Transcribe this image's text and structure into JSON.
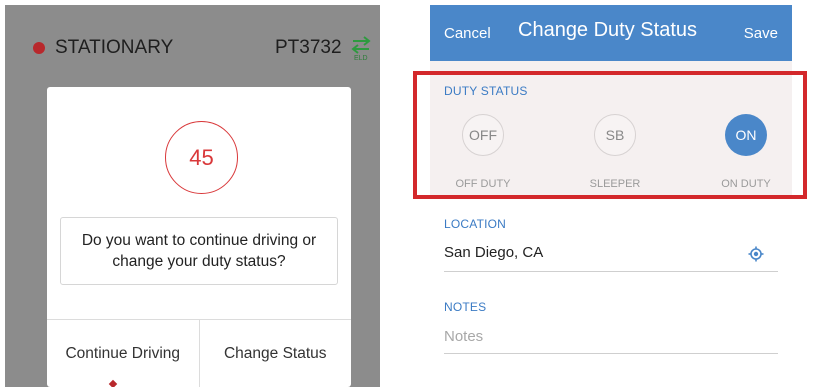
{
  "left_screen": {
    "status": "STATIONARY",
    "vehicle_id": "PT3732",
    "eld_label": "ELD",
    "dialog": {
      "countdown": "45",
      "question": "Do you want to continue driving or change your duty status?",
      "continue_label": "Continue Driving",
      "change_label": "Change Status"
    }
  },
  "right_screen": {
    "nav": {
      "cancel_label": "Cancel",
      "title": "Change Duty Status",
      "save_label": "Save"
    },
    "duty_status": {
      "label": "DUTY STATUS",
      "options": [
        {
          "code": "OFF",
          "caption": "OFF DUTY",
          "selected": false
        },
        {
          "code": "SB",
          "caption": "SLEEPER",
          "selected": false
        },
        {
          "code": "ON",
          "caption": "ON DUTY",
          "selected": true
        }
      ]
    },
    "location": {
      "label": "LOCATION",
      "value": "San Diego, CA"
    },
    "notes": {
      "label": "NOTES",
      "placeholder": "Notes",
      "value": ""
    }
  },
  "colors": {
    "accent_blue": "#4a87c9",
    "alert_red": "#d9383a",
    "highlight_red": "#d3282b",
    "eld_green": "#2e9a3f"
  },
  "icons": [
    "status-dot",
    "eld-connection-icon",
    "locate-icon"
  ]
}
